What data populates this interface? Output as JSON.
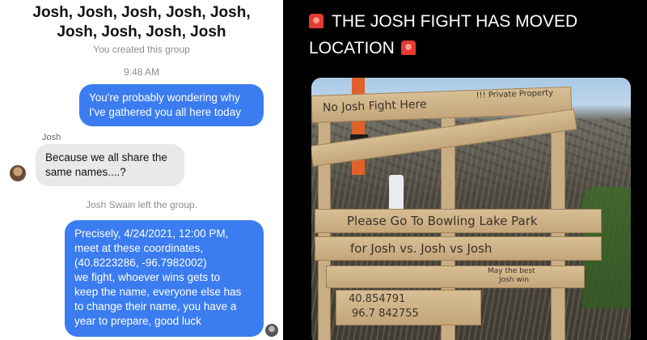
{
  "chat": {
    "title_lines": [
      "Josh, Josh, Josh, Josh, Josh,",
      "Josh, Josh, Josh, Josh"
    ],
    "created_note": "You created this group",
    "timestamp": "9:48 AM",
    "msg1_lines": [
      "You're probably wondering why",
      "I've gathered you all here today"
    ],
    "sender_name": "Josh",
    "msg2_lines": [
      "Because we all share the",
      "same names....?"
    ],
    "left_note": "Josh Swain left the group.",
    "msg3_lines": [
      "Precisely, 4/24/2021, 12:00 PM,",
      "meet at these coordinates,",
      "(40.8223286, -96.7982002)",
      "we fight, whoever wins gets to",
      "keep the name, everyone else has",
      "to change their name, you have a",
      "year to prepare, good luck"
    ],
    "colors": {
      "outgoing_bubble": "#3b7cf0",
      "incoming_bubble": "#e9e9eb"
    }
  },
  "tweet": {
    "text_line1": "THE JOSH FIGHT HAS MOVED",
    "text_line2": "LOCATION",
    "emoji": "rotating-light",
    "sign": {
      "top_text": "No Josh Fight Here",
      "top_note": "!!! Private Property",
      "main_line1": "Please Go To Bowling Lake Park",
      "main_line2": "for Josh vs. Josh vs Josh",
      "small_note_line1": "May the best",
      "small_note_line2": "Josh win",
      "coords_line1": "40.854791",
      "coords_line2": "96.7 842755"
    }
  }
}
